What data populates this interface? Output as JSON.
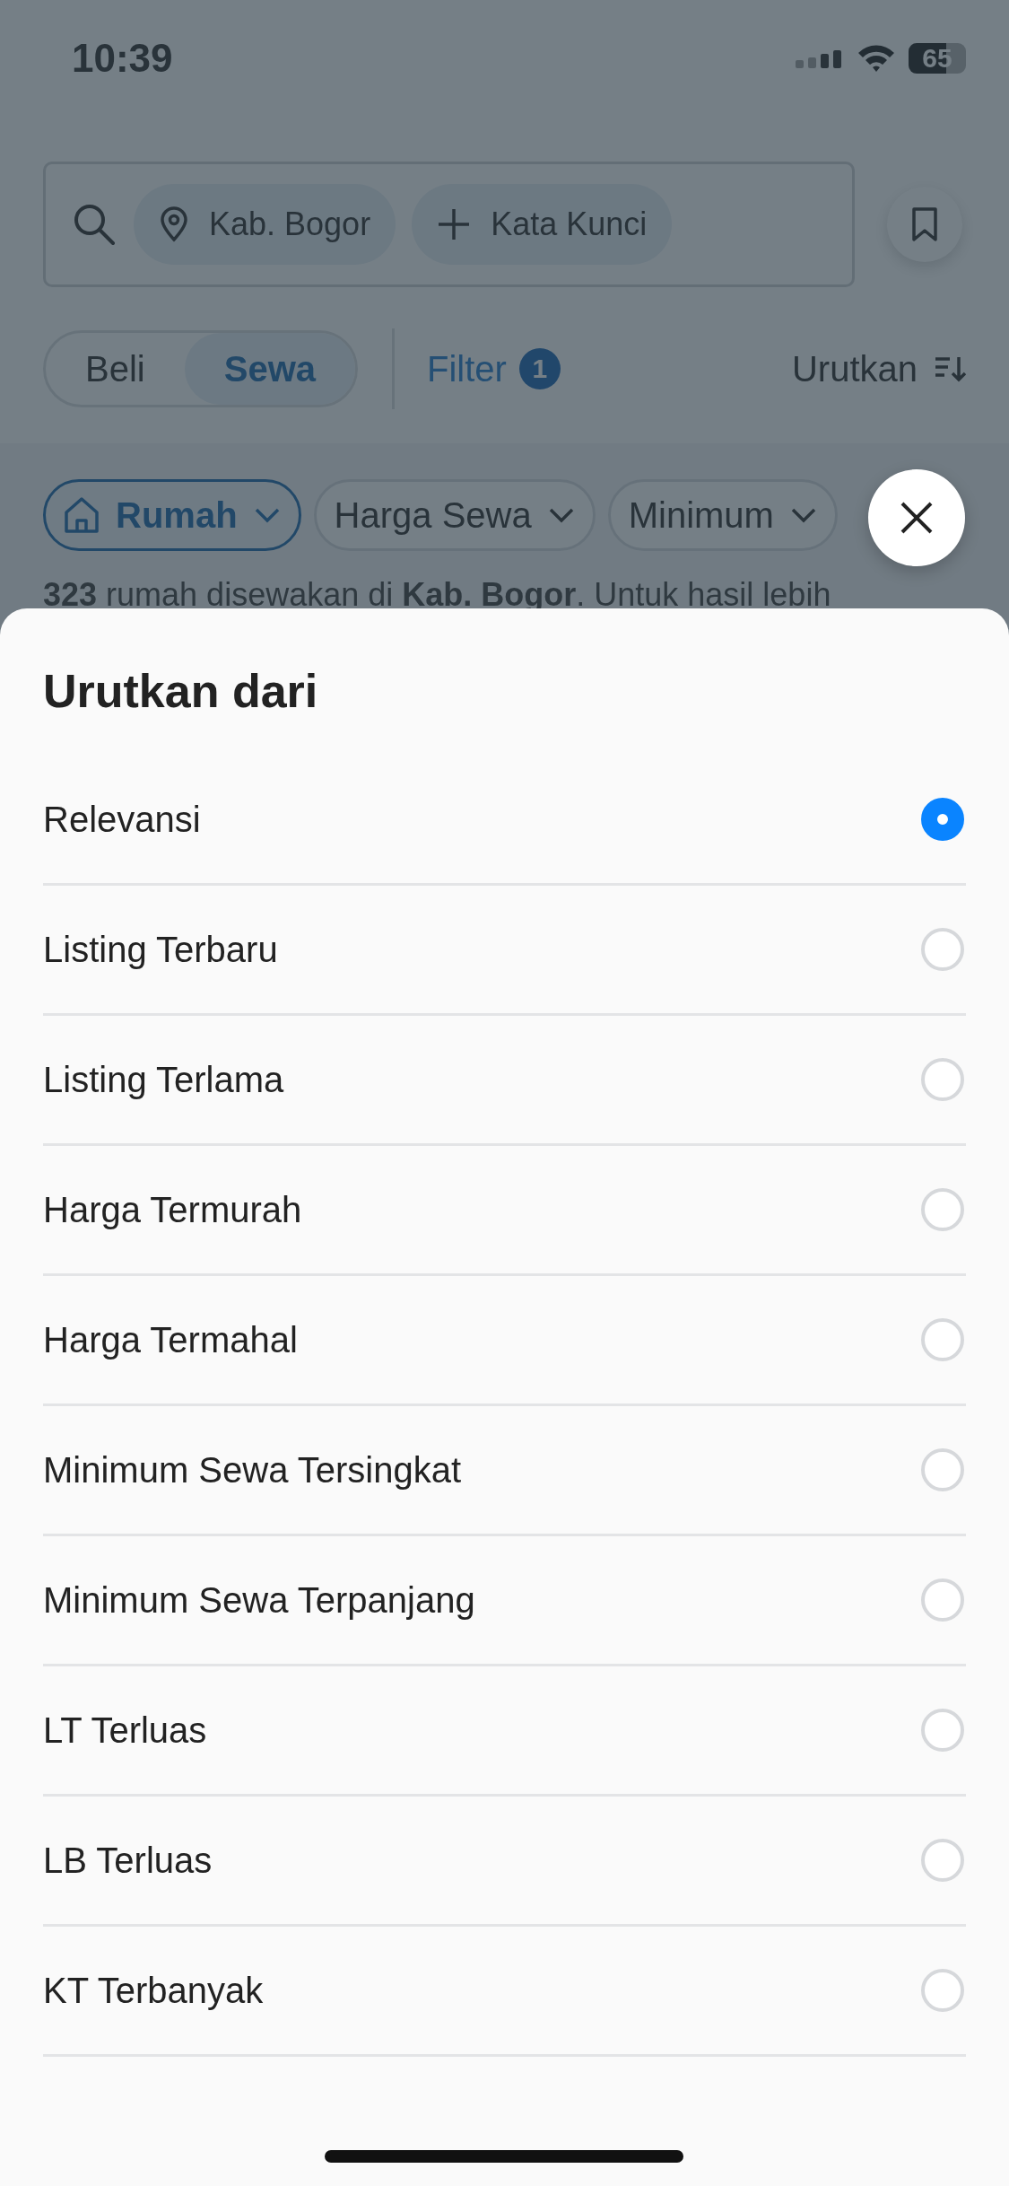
{
  "status_bar": {
    "time": "10:39",
    "battery": "65"
  },
  "search": {
    "location": "Kab. Bogor",
    "keyword": "Kata Kunci"
  },
  "mode_tabs": [
    {
      "label": "Beli",
      "selected": false
    },
    {
      "label": "Sewa",
      "selected": true
    }
  ],
  "filter": {
    "label": "Filter",
    "badge": "1"
  },
  "sort": {
    "label": "Urutkan"
  },
  "chips": [
    {
      "label": "Rumah",
      "kind": "category",
      "selected": true
    },
    {
      "label": "Harga Sewa",
      "kind": "dropdown",
      "selected": false
    },
    {
      "label": "Minimum",
      "kind": "dropdown",
      "selected": false
    }
  ],
  "result_text": "**323** rumah disewakan di **Kab. Bogor**. Untuk hasil lebih",
  "sheet": {
    "title": "Urutkan dari",
    "options": [
      {
        "label": "Relevansi",
        "selected": true
      },
      {
        "label": "Listing Terbaru",
        "selected": false
      },
      {
        "label": "Listing Terlama",
        "selected": false
      },
      {
        "label": "Harga Termurah",
        "selected": false
      },
      {
        "label": "Harga Termahal",
        "selected": false
      },
      {
        "label": "Minimum Sewa Tersingkat",
        "selected": false
      },
      {
        "label": "Minimum Sewa Terpanjang",
        "selected": false
      },
      {
        "label": "LT Terluas",
        "selected": false
      },
      {
        "label": "LB Terluas",
        "selected": false
      },
      {
        "label": "KT Terbanyak",
        "selected": false
      }
    ]
  }
}
